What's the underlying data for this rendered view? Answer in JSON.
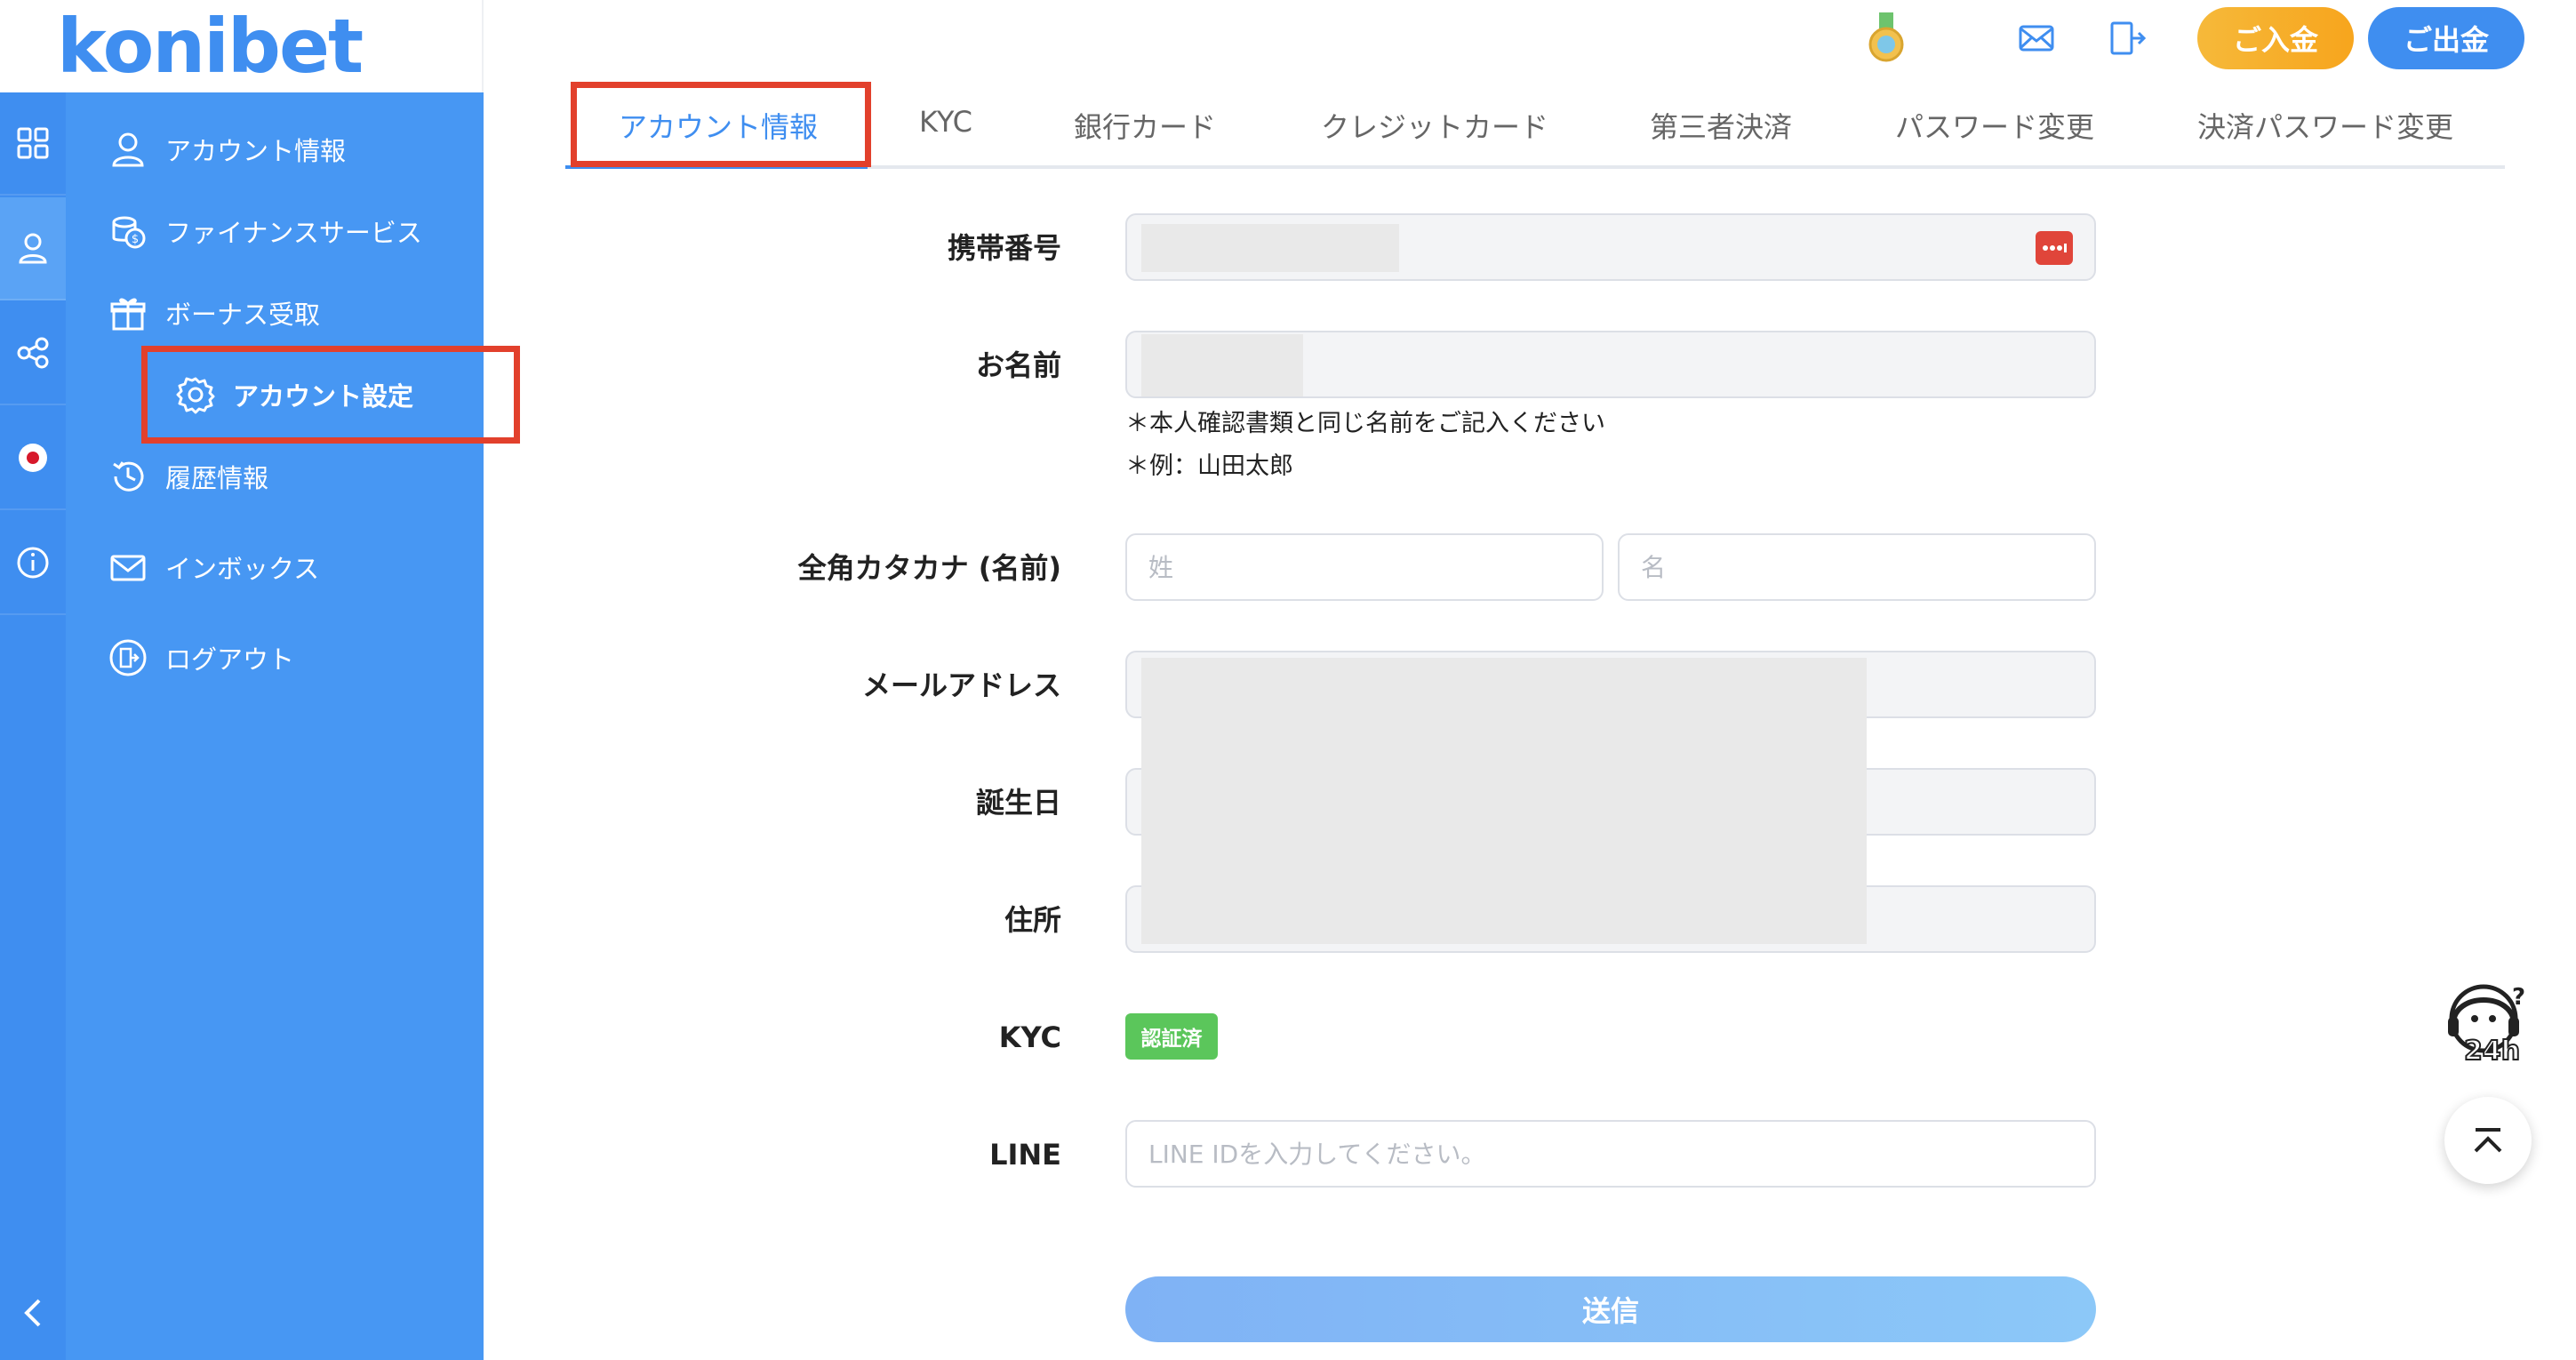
{
  "header": {
    "logo_text": "konibet",
    "deposit_label": "ご入金",
    "withdraw_label": "ご出金"
  },
  "sidebar": {
    "items": [
      {
        "label": "アカウント情報",
        "icon": "user-icon"
      },
      {
        "label": "ファイナンスサービス",
        "icon": "coin-icon"
      },
      {
        "label": "ボーナス受取",
        "icon": "gift-icon"
      },
      {
        "label": "アカウント設定",
        "icon": "gear-icon"
      },
      {
        "label": "履歴情報",
        "icon": "history-icon"
      },
      {
        "label": "インボックス",
        "icon": "mail-icon"
      },
      {
        "label": "ログアウト",
        "icon": "logout-icon"
      }
    ]
  },
  "tabs": [
    {
      "label": "アカウント情報"
    },
    {
      "label": "KYC"
    },
    {
      "label": "銀行カード"
    },
    {
      "label": "クレジットカード"
    },
    {
      "label": "第三者決済"
    },
    {
      "label": "パスワード変更"
    },
    {
      "label": "決済パスワード変更"
    }
  ],
  "form": {
    "phone_label": "携帯番号",
    "name_label": "お名前",
    "name_note_1": "＊本人確認書類と同じ名前をご記入ください",
    "name_note_2": "＊例：山田太郎",
    "kana_label": "全角カタカナ (名前)",
    "kana_last_placeholder": "姓",
    "kana_first_placeholder": "名",
    "email_label": "メールアドレス",
    "birthday_label": "誕生日",
    "address_label": "住所",
    "kyc_label": "KYC",
    "kyc_status": "認証済",
    "line_label": "LINE",
    "line_placeholder": "LINE IDを入力してください。",
    "submit_label": "送信"
  },
  "colors": {
    "primary": "#3f8ef0",
    "sidebar": "#4797f3",
    "deposit": "#f7a51d",
    "highlight": "#e2402c",
    "kyc_badge": "#5bc65b"
  }
}
